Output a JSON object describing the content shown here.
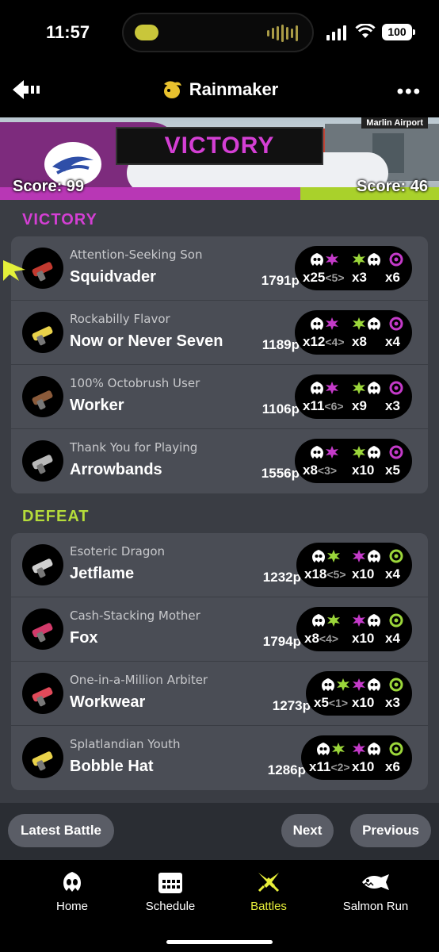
{
  "status": {
    "time": "11:57",
    "battery": "100"
  },
  "header": {
    "title": "Rainmaker",
    "back_icon": "back-arrow-icon",
    "more_icon": "ellipsis-icon"
  },
  "banner": {
    "stage": "Marlin Airport",
    "result": "VICTORY",
    "score_left": "Score: 99",
    "score_right": "Score: 46"
  },
  "colors": {
    "victory": "#d43fd4",
    "defeat": "#b5dc3a",
    "panel": "#4a4d55",
    "bg": "#3a3d44"
  },
  "teams": [
    {
      "label": "VICTORY",
      "players": [
        {
          "title": "Attention-Seeking Son",
          "name": "Squidvader",
          "points": "1791p",
          "splat": "x25",
          "special_count": "<5>",
          "death": "x3",
          "special": "x6",
          "weapon_icon": "splattershot-icon"
        },
        {
          "title": "Rockabilly Flavor",
          "name": "Now or Never Seven",
          "points": "1189p",
          "splat": "x12",
          "special_count": "<4>",
          "death": "x8",
          "special": "x4",
          "weapon_icon": "blaster-icon"
        },
        {
          "title": "100% Octobrush User",
          "name": "Worker",
          "points": "1106p",
          "splat": "x11",
          "special_count": "<6>",
          "death": "x9",
          "special": "x3",
          "weapon_icon": "octobrush-icon"
        },
        {
          "title": "Thank You for Playing",
          "name": "Arrowbands",
          "points": "1556p",
          "splat": "x8",
          "special_count": "<3>",
          "death": "x10",
          "special": "x5",
          "weapon_icon": "wiper-icon"
        }
      ]
    },
    {
      "label": "DEFEAT",
      "players": [
        {
          "title": "Esoteric Dragon",
          "name": "Jetflame",
          "points": "1232p",
          "splat": "x18",
          "special_count": "<5>",
          "death": "x10",
          "special": "x4",
          "weapon_icon": "splatling-icon"
        },
        {
          "title": "Cash-Stacking Mother",
          "name": "Fox",
          "points": "1794p",
          "splat": "x8",
          "special_count": "<4>",
          "death": "x10",
          "special": "x4",
          "weapon_icon": "charger-icon"
        },
        {
          "title": "One-in-a-Million Arbiter",
          "name": "Workwear",
          "points": "1273p",
          "splat": "x5",
          "special_count": "<1>",
          "death": "x10",
          "special": "x3",
          "weapon_icon": "dualies-icon"
        },
        {
          "title": "Splatlandian Youth",
          "name": "Bobble Hat",
          "points": "1286p",
          "splat": "x11",
          "special_count": "<2>",
          "death": "x10",
          "special": "x6",
          "weapon_icon": "blaster-icon"
        }
      ]
    }
  ],
  "buttons": {
    "latest": "Latest Battle",
    "next": "Next",
    "previous": "Previous"
  },
  "tabs": [
    {
      "label": "Home",
      "icon": "squid-icon"
    },
    {
      "label": "Schedule",
      "icon": "calendar-icon"
    },
    {
      "label": "Battles",
      "icon": "battles-icon",
      "active": true
    },
    {
      "label": "Salmon Run",
      "icon": "salmon-icon"
    }
  ]
}
